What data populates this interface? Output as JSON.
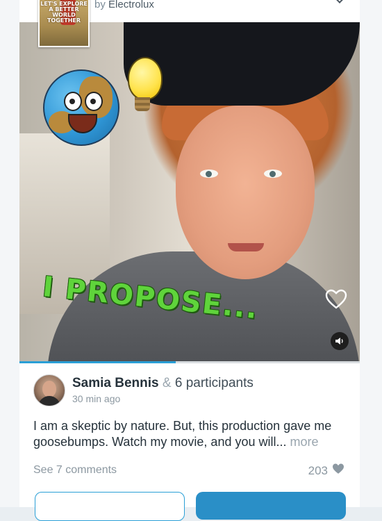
{
  "header": {
    "poster_text_lines": [
      "LET'S EXPLORE",
      "A BETTER",
      "WORLD",
      "TOGETHER"
    ],
    "by_prefix": "by",
    "by_brand": "Electrolux"
  },
  "video": {
    "overlay_text": "I PROPOSE...",
    "progress_fraction": 0.46
  },
  "post": {
    "author_name": "Samia Bennis",
    "ampersand": "&",
    "participants": "6 participants",
    "time_ago": "30 min ago",
    "description": "I am a skeptic by nature. But, this production gave me goosebumps. Watch my movie, and you will...",
    "more_label": "more",
    "comments_label": "See 7 comments",
    "likes_count": "203"
  },
  "icons": {
    "heart": "heart-outline-icon",
    "sound": "speaker-icon",
    "likes": "heart-filled-icon",
    "chevron": "chevron-down-icon"
  },
  "colors": {
    "accent": "#2a9fd6",
    "button_filled": "#2a8fc7",
    "muted_text": "#8c98a1",
    "overlay_green": "#5fd43b"
  }
}
